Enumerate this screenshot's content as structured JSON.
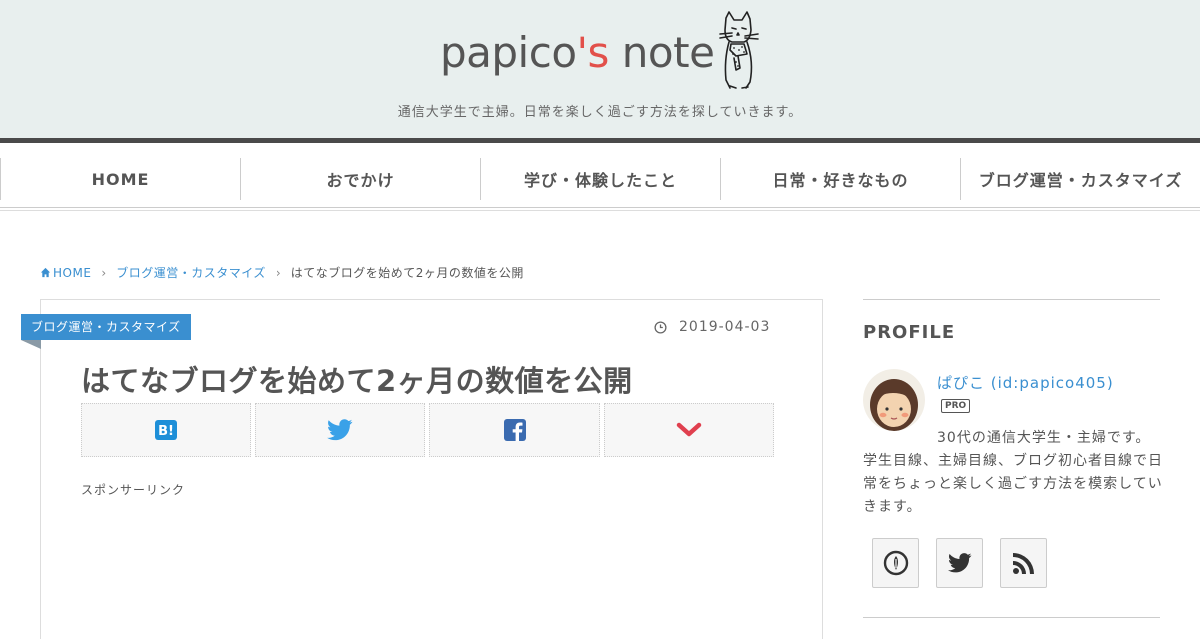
{
  "header": {
    "logo_main": "papico",
    "logo_accent": "'s",
    "logo_end": " note",
    "tagline": "通信大学生で主婦。日常を楽しく過ごす方法を探していきます。"
  },
  "nav": {
    "items": [
      "HOME",
      "おでかけ",
      "学び・体験したこと",
      "日常・好きなもの",
      "ブログ運営・カスタマイズ"
    ]
  },
  "breadcrumb": {
    "home": "HOME",
    "category": "ブログ運営・カスタマイズ",
    "current": "はてなブログを始めて2ヶ月の数値を公開"
  },
  "article": {
    "category_label": "ブログ運営・カスタマイズ",
    "date": "2019-04-03",
    "title": "はてなブログを始めて2ヶ月の数値を公開",
    "sponsor": "スポンサーリンク"
  },
  "sidebar": {
    "heading": "PROFILE",
    "name": "ぱぴこ (id:papico405)",
    "badge": "PRO",
    "description": "30代の通信大学生・主婦です。学生目線、主婦目線、ブログ初心者目線で日常をちょっと楽しく過ごす方法を模索していきます。"
  },
  "colors": {
    "accent_red": "#e2504a",
    "link_blue": "#3a8fd0",
    "header_bg": "#e8efee",
    "hatena_blue": "#1e8fd8",
    "twitter_blue": "#3aa1e8",
    "facebook_blue": "#3b6bb0",
    "pocket_red": "#e0404f"
  },
  "icons": {
    "share": [
      "hatena-bookmark-icon",
      "twitter-icon",
      "facebook-icon",
      "pocket-icon"
    ],
    "social": [
      "feedly-icon",
      "twitter-icon",
      "rss-icon"
    ]
  }
}
